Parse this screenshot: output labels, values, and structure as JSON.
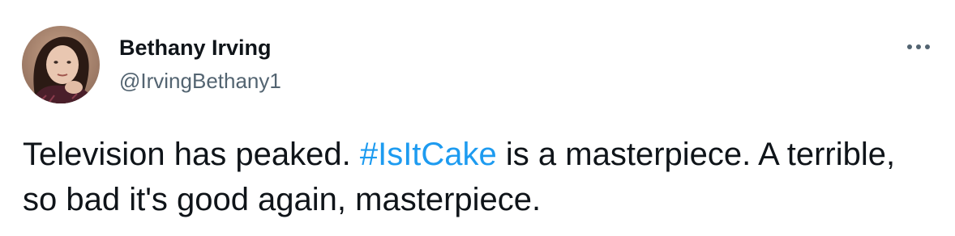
{
  "author": {
    "name": "Bethany Irving",
    "handle": "@IrvingBethany1",
    "avatar_icon": "profile-photo-avatar"
  },
  "menu": {
    "more_icon": "more-options-ellipsis-icon"
  },
  "tweet": {
    "text_before": "Television has peaked. ",
    "hashtag": "#IsItCake",
    "text_after": " is a masterpiece. A terrible, so bad it's good again, masterpiece."
  },
  "colors": {
    "text_primary": "#0f1419",
    "text_secondary": "#536471",
    "link": "#1d9bf0",
    "background": "#ffffff"
  }
}
